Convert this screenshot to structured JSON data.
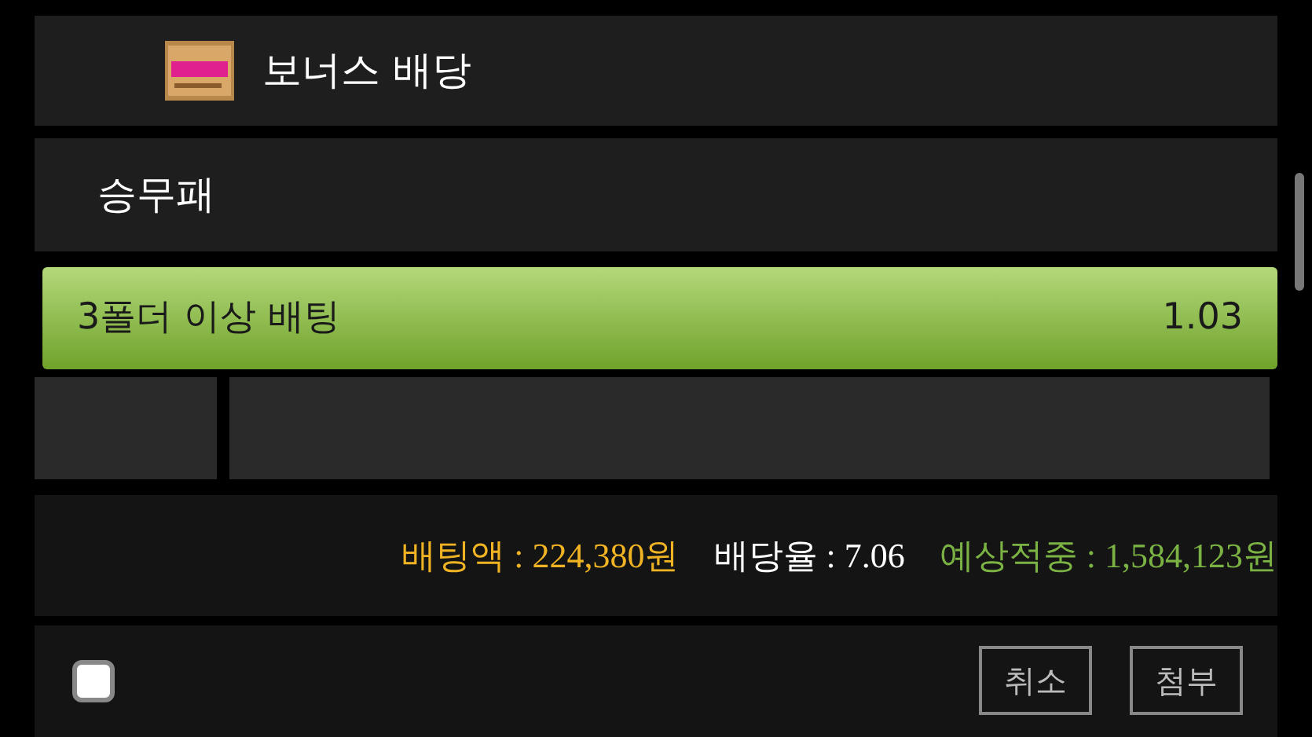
{
  "bonus": {
    "title": "보너스 배당"
  },
  "market": {
    "label": "승무패"
  },
  "options": [
    {
      "label": "3폴더 이상 배팅",
      "odds": "1.03",
      "selected": true
    }
  ],
  "summary": [
    {
      "text": "배팅액 : 224,380원",
      "color": "#f0b323"
    },
    {
      "text": "배당율 : 7.06",
      "color": "#ffffff"
    },
    {
      "text": "예상적중 : 1,584,123원",
      "color": "#7bb244"
    }
  ],
  "footer": {
    "checked": false,
    "buttons": [
      "취소",
      "첨부"
    ]
  }
}
